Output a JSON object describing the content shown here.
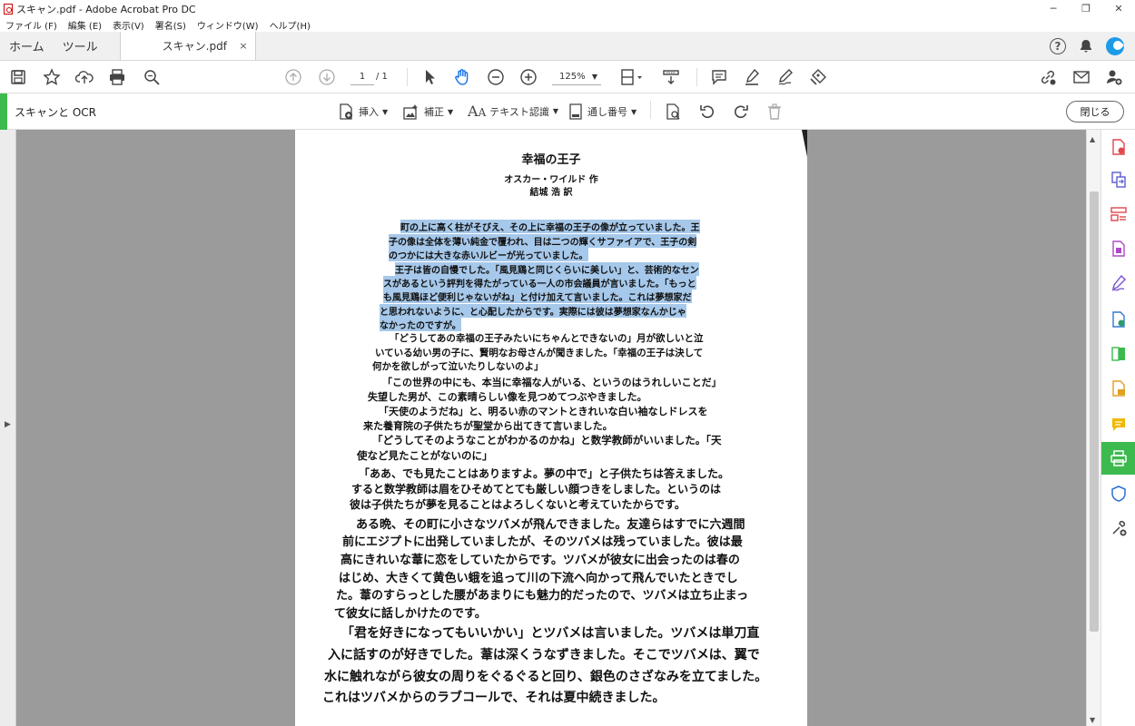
{
  "window": {
    "title": "スキャン.pdf - Adobe Acrobat Pro DC",
    "minimize": "─",
    "maximize": "❐",
    "close": "✕"
  },
  "menu": [
    "ファイル (F)",
    "編集 (E)",
    "表示(V)",
    "署名(S)",
    "ウィンドウ(W)",
    "ヘルプ(H)"
  ],
  "tabs": {
    "home": "ホーム",
    "tools": "ツール",
    "document": "スキャン.pdf",
    "close_glyph": "×"
  },
  "toolbar": {
    "page_current": "1",
    "page_total": "/ 1",
    "zoom": "125%"
  },
  "scan": {
    "title": "スキャンと OCR",
    "insert": "挿入",
    "enhance": "補正",
    "text_recognition": "テキスト認識",
    "bates": "通し番号",
    "close_button": "閉じる"
  },
  "document": {
    "title": "幸福の王子",
    "author": "オスカー・ワイルド 作",
    "translator": "結城 浩 訳",
    "lines": [
      "町の上に高く柱がそびえ、その上に幸福の王子の像が立っていました。王",
      "子の像は全体を薄い純金で覆われ、目は二つの輝くサファイアで、王子の剣",
      "のつかには大きな赤いルビーが光っていました。",
      "王子は皆の自慢でした。「風見鶏と同じくらいに美しい」と、芸術的なセン",
      "スがあるという評判を得たがっている一人の市会議員が言いました。「もっと",
      "も風見鶏ほど便利じゃないがね」と付け加えて言いました。これは夢想家だ",
      "と思われないように、と心配したからです。実際には彼は夢想家なんかじゃ",
      "なかったのですが。",
      "「どうしてあの幸福の王子みたいにちゃんとできないの」月が欲しいと泣",
      "いている幼い男の子に、賢明なお母さんが聞きました。「幸福の王子は決して",
      "何かを欲しがって泣いたりしないのよ」",
      "「この世界の中にも、本当に幸福な人がいる、というのはうれしいことだ」",
      "失望した男が、この素晴らしい像を見つめてつぶやきました。",
      "「天使のようだね」と、明るい赤のマントときれいな白い袖なしドレスを",
      "来た養育院の子供たちが聖堂から出てきて言いました。",
      "「どうしてそのようなことがわかるのかね」と数学教師がいいました。「天",
      "使など見たことがないのに」",
      "「ああ、でも見たことはありますよ。夢の中で」と子供たちは答えました。",
      "すると数学教師は眉をひそめてとても厳しい顔つきをしました。というのは",
      "彼は子供たちが夢を見ることはよろしくないと考えていたからです。",
      "ある晩、その町に小さなツバメが飛んできました。友達らはすでに六週間",
      "前にエジプトに出発していましたが、そのツバメは残っていました。彼は最",
      "高にきれいな葦に恋をしていたからです。ツバメが彼女に出会ったのは春の",
      "はじめ、大きくて黄色い蛾を追って川の下流へ向かって飛んでいたときでし",
      "た。葦のすらっとした腰があまりにも魅力的だったので、ツバメは立ち止まっ",
      "て彼女に話しかけたのです。",
      "「君を好きになってもいいかい」とツバメは言いました。ツバメは単刀直",
      "入に話すのが好きでした。葦は深くうなずきました。そこでツバメは、翼で",
      "水に触れながら彼女の周りをぐるぐると回り、銀色のさざなみを立てました。",
      "これはツバメからのラブコールで、それは夏中続きました。"
    ]
  },
  "colors": {
    "accent_green": "#3dba4e",
    "selection": "#a6c8ea",
    "avatar_blue": "#1e9be8"
  },
  "icons": {
    "toolbar": [
      "save-icon",
      "star-icon",
      "upload-icon",
      "print-icon",
      "search-icon",
      "prev-page-icon",
      "next-page-icon",
      "select-cursor-icon",
      "hand-icon",
      "zoom-out-icon",
      "zoom-in-icon",
      "page-layout-icon",
      "scroll-mode-icon",
      "comment-icon",
      "highlight-icon",
      "sign-icon",
      "stamp-icon",
      "share-link-icon",
      "mail-icon",
      "add-user-icon"
    ],
    "right_panel": [
      "create-pdf-icon",
      "combine-icon",
      "organize-icon",
      "export-icon",
      "fill-sign-icon",
      "edit-pdf-icon",
      "compare-icon",
      "stamp-pdf-icon",
      "comment-icon",
      "scan-icon",
      "protect-icon",
      "more-tools-icon"
    ]
  }
}
